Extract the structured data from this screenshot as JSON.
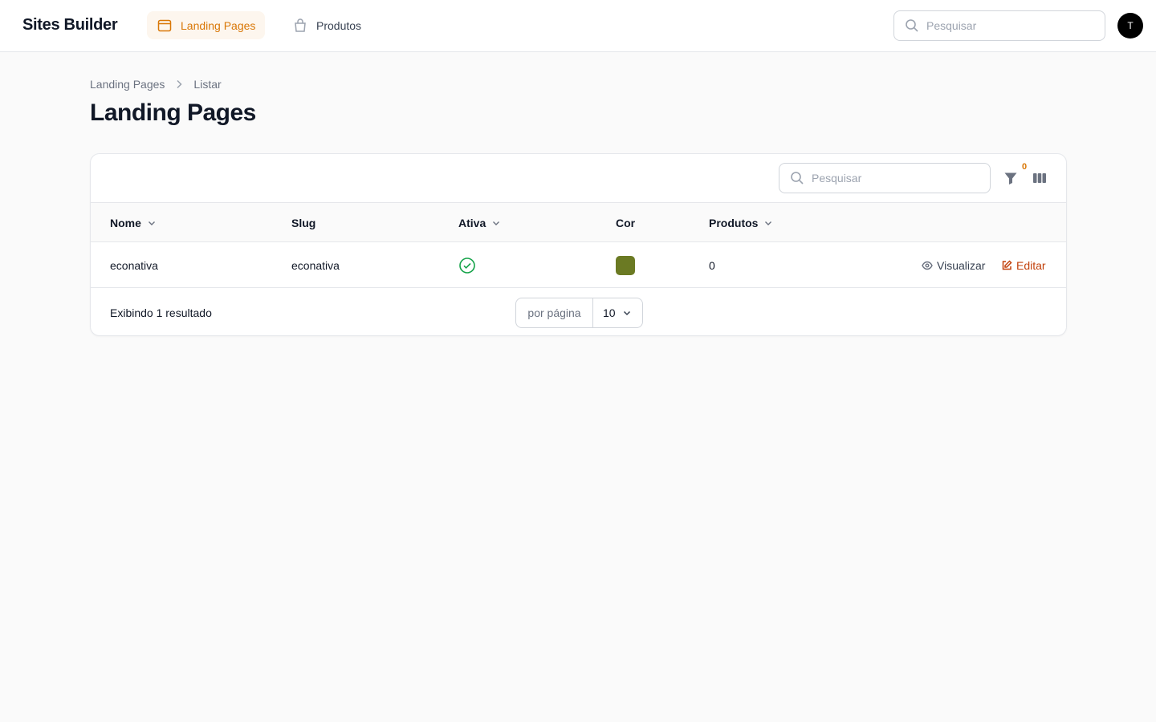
{
  "brand": "Sites Builder",
  "nav": {
    "items": [
      {
        "label": "Landing Pages",
        "icon": "browser-window-icon",
        "active": true
      },
      {
        "label": "Produtos",
        "icon": "shopping-bag-icon",
        "active": false
      }
    ]
  },
  "global_search": {
    "placeholder": "Pesquisar"
  },
  "user": {
    "initial": "T"
  },
  "breadcrumb": [
    "Landing Pages",
    "Listar"
  ],
  "page_title": "Landing Pages",
  "table": {
    "search_placeholder": "Pesquisar",
    "filter_count": "0",
    "columns": [
      "Nome",
      "Slug",
      "Ativa",
      "Cor",
      "Produtos"
    ],
    "rows": [
      {
        "nome": "econativa",
        "slug": "econativa",
        "ativa": true,
        "cor": "#6b7a23",
        "produtos": "0"
      }
    ],
    "actions": {
      "view": "Visualizar",
      "edit": "Editar"
    },
    "footer": {
      "result_text": "Exibindo 1 resultado",
      "per_page_label": "por página",
      "per_page_value": "10"
    }
  },
  "colors": {
    "accent": "#d97706",
    "edit": "#c2410c",
    "success": "#16a34a"
  }
}
